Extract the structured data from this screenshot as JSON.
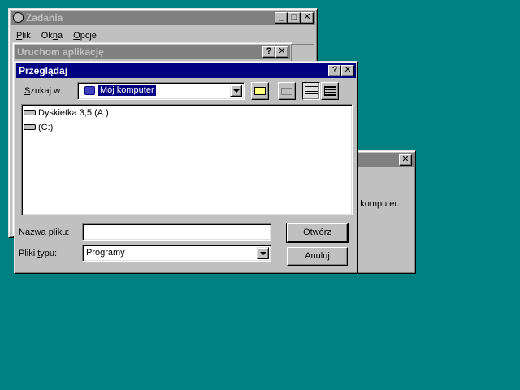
{
  "taskman": {
    "title": "Zadania",
    "menu": [
      "Plik",
      "Okna",
      "Opcje"
    ]
  },
  "run_dialog": {
    "title": "Uruchom aplikację"
  },
  "back_dialog": {
    "text_fragment": "m komputer."
  },
  "browse": {
    "title": "Przeglądaj",
    "look_in_label": "Szukaj w:",
    "look_in_value": "Mój komputer",
    "items": [
      {
        "label": "Dyskietka 3,5 (A:)"
      },
      {
        "label": "(C:)"
      }
    ],
    "filename_label": "Nazwa pliku:",
    "filename_value": "",
    "filetype_label": "Pliki typu:",
    "filetype_value": "Programy",
    "open_label": "Otwórz",
    "cancel_label": "Anuluj"
  }
}
